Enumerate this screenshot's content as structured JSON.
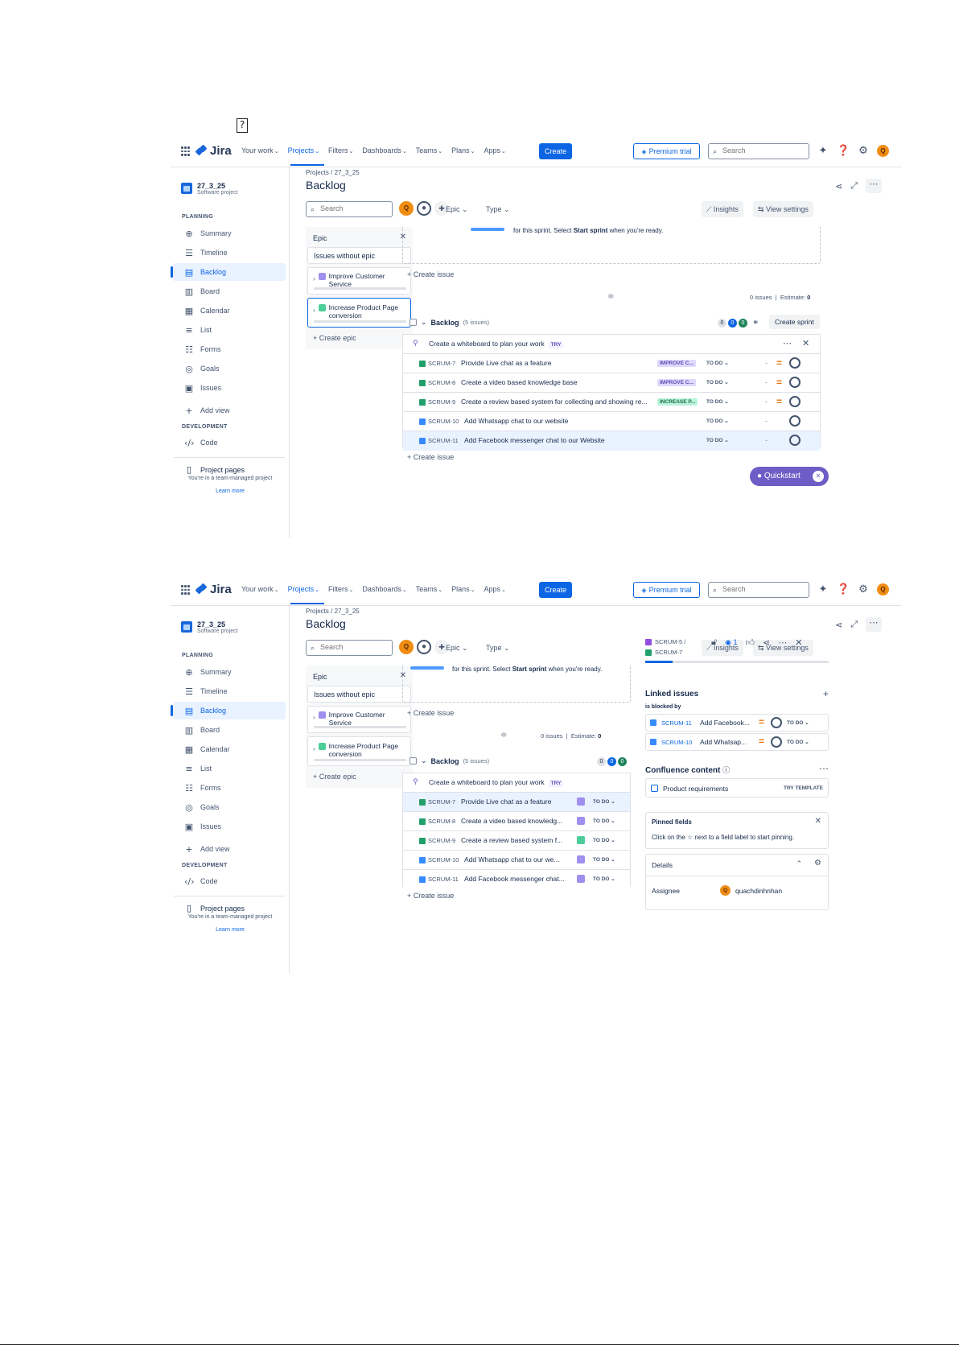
{
  "doc": {
    "missing_glyph": "?"
  },
  "nav": {
    "logo_text": "Jira",
    "items": [
      {
        "label": "Your work"
      },
      {
        "label": "Projects"
      },
      {
        "label": "Filters"
      },
      {
        "label": "Dashboards"
      },
      {
        "label": "Teams"
      },
      {
        "label": "Plans"
      },
      {
        "label": "Apps"
      }
    ],
    "active_item": "Projects",
    "create_label": "Create",
    "premium_label": "Premium trial",
    "search_placeholder": "Search",
    "user_initial": "Q",
    "icons": [
      "bell-icon",
      "help-icon",
      "settings-icon"
    ]
  },
  "sidebar": {
    "project_name": "27_3_25",
    "project_type": "Software project",
    "planning_heading": "PLANNING",
    "items": [
      {
        "label": "Summary",
        "icon": "globe-icon"
      },
      {
        "label": "Timeline",
        "icon": "timeline-icon"
      },
      {
        "label": "Backlog",
        "icon": "backlog-icon"
      },
      {
        "label": "Board",
        "icon": "board-icon"
      },
      {
        "label": "Calendar",
        "icon": "calendar-icon"
      },
      {
        "label": "List",
        "icon": "list-icon"
      },
      {
        "label": "Forms",
        "icon": "forms-icon"
      },
      {
        "label": "Goals",
        "icon": "goals-icon"
      },
      {
        "label": "Issues",
        "icon": "issues-icon"
      }
    ],
    "add_view": "Add view",
    "development_heading": "DEVELOPMENT",
    "code_label": "Code",
    "project_pages": "Project pages",
    "team_managed": "You're in a team-managed project",
    "learn_more": "Learn more"
  },
  "main": {
    "breadcrumb_projects": "Projects",
    "breadcrumb_sep": "/",
    "breadcrumb_project": "27_3_25",
    "title": "Backlog",
    "search_placeholder": "Search",
    "epic_filter": "Epic",
    "type_filter": "Type",
    "insights": "Insights",
    "view_settings": "View settings"
  },
  "epic_panel": {
    "title": "Epic",
    "issues_without_epic": "Issues without epic",
    "epics": [
      {
        "name": "Improve Customer Service",
        "color": "#9f8fef"
      },
      {
        "name": "Increase Product Page conversion",
        "color": "#4bce97"
      }
    ],
    "create_epic": "Create epic"
  },
  "sprint": {
    "text_prefix": "for this sprint. Select ",
    "text_bold": "Start sprint",
    "text_suffix": " when you're ready.",
    "create_issue": "Create issue",
    "issues_count": "0 issues",
    "estimate_label": "Estimate:",
    "estimate_value": "0"
  },
  "backlog": {
    "title": "Backlog",
    "count": "(5 issues)",
    "pills": [
      "0",
      "0",
      "0"
    ],
    "create_sprint": "Create sprint",
    "whiteboard_text": "Create a whiteboard to plan your work",
    "try_label": "TRY",
    "create_issue": "Create issue",
    "issues": [
      {
        "key": "SCRUM-7",
        "summary": "Provide Live chat as a feature",
        "short": "Provide Live chat as a feature",
        "type": "story",
        "epic": "IMPROVE C...",
        "epic_color": "#9f8fef",
        "status": "TO DO",
        "estimate": "-"
      },
      {
        "key": "SCRUM-8",
        "summary": "Create a video based knowledge base",
        "short": "Create a video based knowledg...",
        "type": "story",
        "epic": "IMPROVE C...",
        "epic_color": "#9f8fef",
        "status": "TO DO",
        "estimate": "-"
      },
      {
        "key": "SCRUM-9",
        "summary": "Create a review based system for collecting and showing re...",
        "short": "Create a review based system f...",
        "type": "story",
        "epic": "INCREASE P...",
        "epic_color": "#4bce97",
        "status": "TO DO",
        "estimate": "-"
      },
      {
        "key": "SCRUM-10",
        "summary": "Add Whatsapp chat to our website",
        "short": "Add Whatsapp chat to our we...",
        "type": "task",
        "epic": "",
        "epic_color": "#9f8fef",
        "status": "TO DO",
        "estimate": "-"
      },
      {
        "key": "SCRUM-11",
        "summary": "Add Facebook messenger chat to our Website",
        "short": "Add Facebook messenger chat...",
        "type": "task",
        "epic": "",
        "epic_color": "#9f8fef",
        "status": "TO DO",
        "estimate": "-"
      }
    ]
  },
  "quickstart": {
    "label": "Quickstart"
  },
  "detail": {
    "parent_key": "SCRUM-5 /",
    "issue_key": "SCRUM-7",
    "watch_count": "1",
    "linked_issues_title": "Linked issues",
    "blocked_by": "is blocked by",
    "links": [
      {
        "key": "SCRUM-11",
        "summary": "Add Facebook...",
        "status": "TO DO"
      },
      {
        "key": "SCRUM-10",
        "summary": "Add Whatsap...",
        "status": "TO DO"
      }
    ],
    "confluence_title": "Confluence content",
    "confluence_item": "Product requirements",
    "try_template": "TRY TEMPLATE",
    "pinned_title": "Pinned fields",
    "pinned_text": "Click on the ☆ next to a field label to start pinning.",
    "details_title": "Details",
    "assignee_label": "Assignee",
    "assignee_initial": "Q",
    "assignee_value": "quachdinhnhan"
  },
  "colors": {
    "accent": "#0c66e4",
    "story": "#22a06b",
    "task": "#388bff",
    "quickstart": "#6e5dc6"
  }
}
